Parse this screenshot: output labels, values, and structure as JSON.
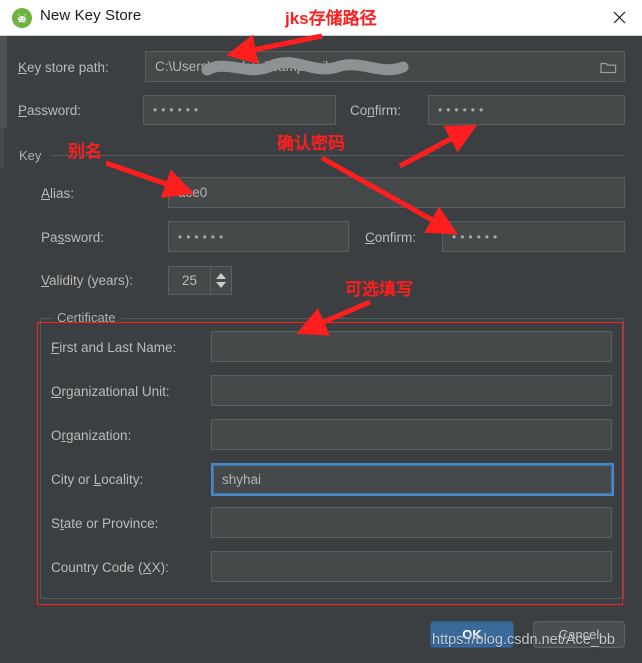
{
  "window": {
    "title": "New Key Store",
    "app_icon": "android-studio-icon",
    "close_icon": "close-icon",
    "titlebar_bg": "#ffffff",
    "body_bg": "#3c3f41"
  },
  "keystore": {
    "path_label": "Key store path:",
    "path_value": "C:\\Users\\      \\.android\\campus.jks",
    "path_value_plain": "C:\\Users\\",
    "path_value_tail": "s.jks",
    "browse_icon": "folder-icon",
    "password_label": "Password:",
    "password_value": "••••••",
    "confirm_label": "Confirm:",
    "confirm_value": "••••••"
  },
  "key_group": {
    "title": "Key",
    "alias_label": "Alias:",
    "alias_value": "ace0",
    "password_label": "Password:",
    "password_value": "••••••",
    "confirm_label": "Confirm:",
    "confirm_value": "••••••",
    "validity_label": "Validity (years):",
    "validity_value": "25",
    "spinner_up_icon": "arrow-up-icon",
    "spinner_down_icon": "arrow-down-icon"
  },
  "certificate": {
    "title": "Certificate",
    "fields": [
      {
        "label": "First and Last Name:",
        "value": "",
        "focused": false
      },
      {
        "label": "Organizational Unit:",
        "value": "",
        "focused": false
      },
      {
        "label": "Organization:",
        "value": "",
        "focused": false
      },
      {
        "label": "City or Locality:",
        "value": "shyhai",
        "focused": true
      },
      {
        "label": "State or Province:",
        "value": "",
        "focused": false
      },
      {
        "label": "Country Code (XX):",
        "value": "",
        "focused": false
      }
    ]
  },
  "buttons": {
    "ok": "OK",
    "cancel": "Cancel",
    "ok_color": "#3a6a9a"
  },
  "annotations": {
    "color": "#ff1e1e",
    "items": [
      {
        "text": "jks存储路径"
      },
      {
        "text": "确认密码"
      },
      {
        "text": "别名"
      },
      {
        "text": "可选填写"
      }
    ]
  },
  "watermark": {
    "text": "https://blog.csdn.net/Ace_bb"
  }
}
